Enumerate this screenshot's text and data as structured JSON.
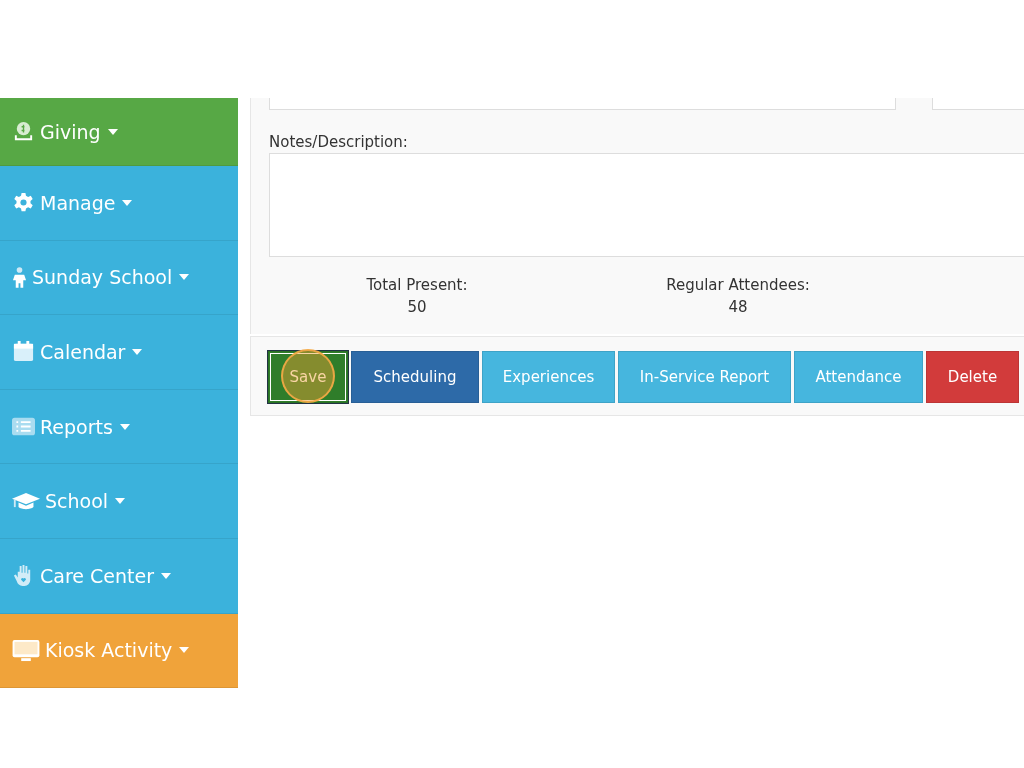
{
  "sidebar": {
    "items": [
      {
        "label": "Giving",
        "kind": "money",
        "color": "#57a845"
      },
      {
        "label": "Manage",
        "kind": "gear",
        "color": "#3bb2dc"
      },
      {
        "label": "Sunday School",
        "kind": "child",
        "color": "#3bb2dc"
      },
      {
        "label": "Calendar",
        "kind": "calendar",
        "color": "#3bb2dc"
      },
      {
        "label": "Reports",
        "kind": "list",
        "color": "#3bb2dc"
      },
      {
        "label": "School",
        "kind": "graduation",
        "color": "#3bb2dc"
      },
      {
        "label": "Care Center",
        "kind": "hand",
        "color": "#3bb2dc"
      },
      {
        "label": "Kiosk Activity",
        "kind": "monitor",
        "color": "#f0a33a"
      }
    ]
  },
  "form": {
    "notes": {
      "label": "Notes/Description:"
    },
    "totals": [
      {
        "label": "Total Present:",
        "value": "50"
      },
      {
        "label": "Regular Attendees:",
        "value": "48"
      }
    ]
  },
  "buttons": [
    {
      "label": "Save",
      "color": "#2f7d2a",
      "focused": true
    },
    {
      "label": "Scheduling",
      "color": "#2d6aa8",
      "focused": false
    },
    {
      "label": "Experiences",
      "color": "#46b6de",
      "focused": false
    },
    {
      "label": "In-Service Report",
      "color": "#46b6de",
      "focused": false
    },
    {
      "label": "Attendance",
      "color": "#46b6de",
      "focused": false
    },
    {
      "label": "Delete",
      "color": "#d23b3b",
      "focused": false
    }
  ]
}
